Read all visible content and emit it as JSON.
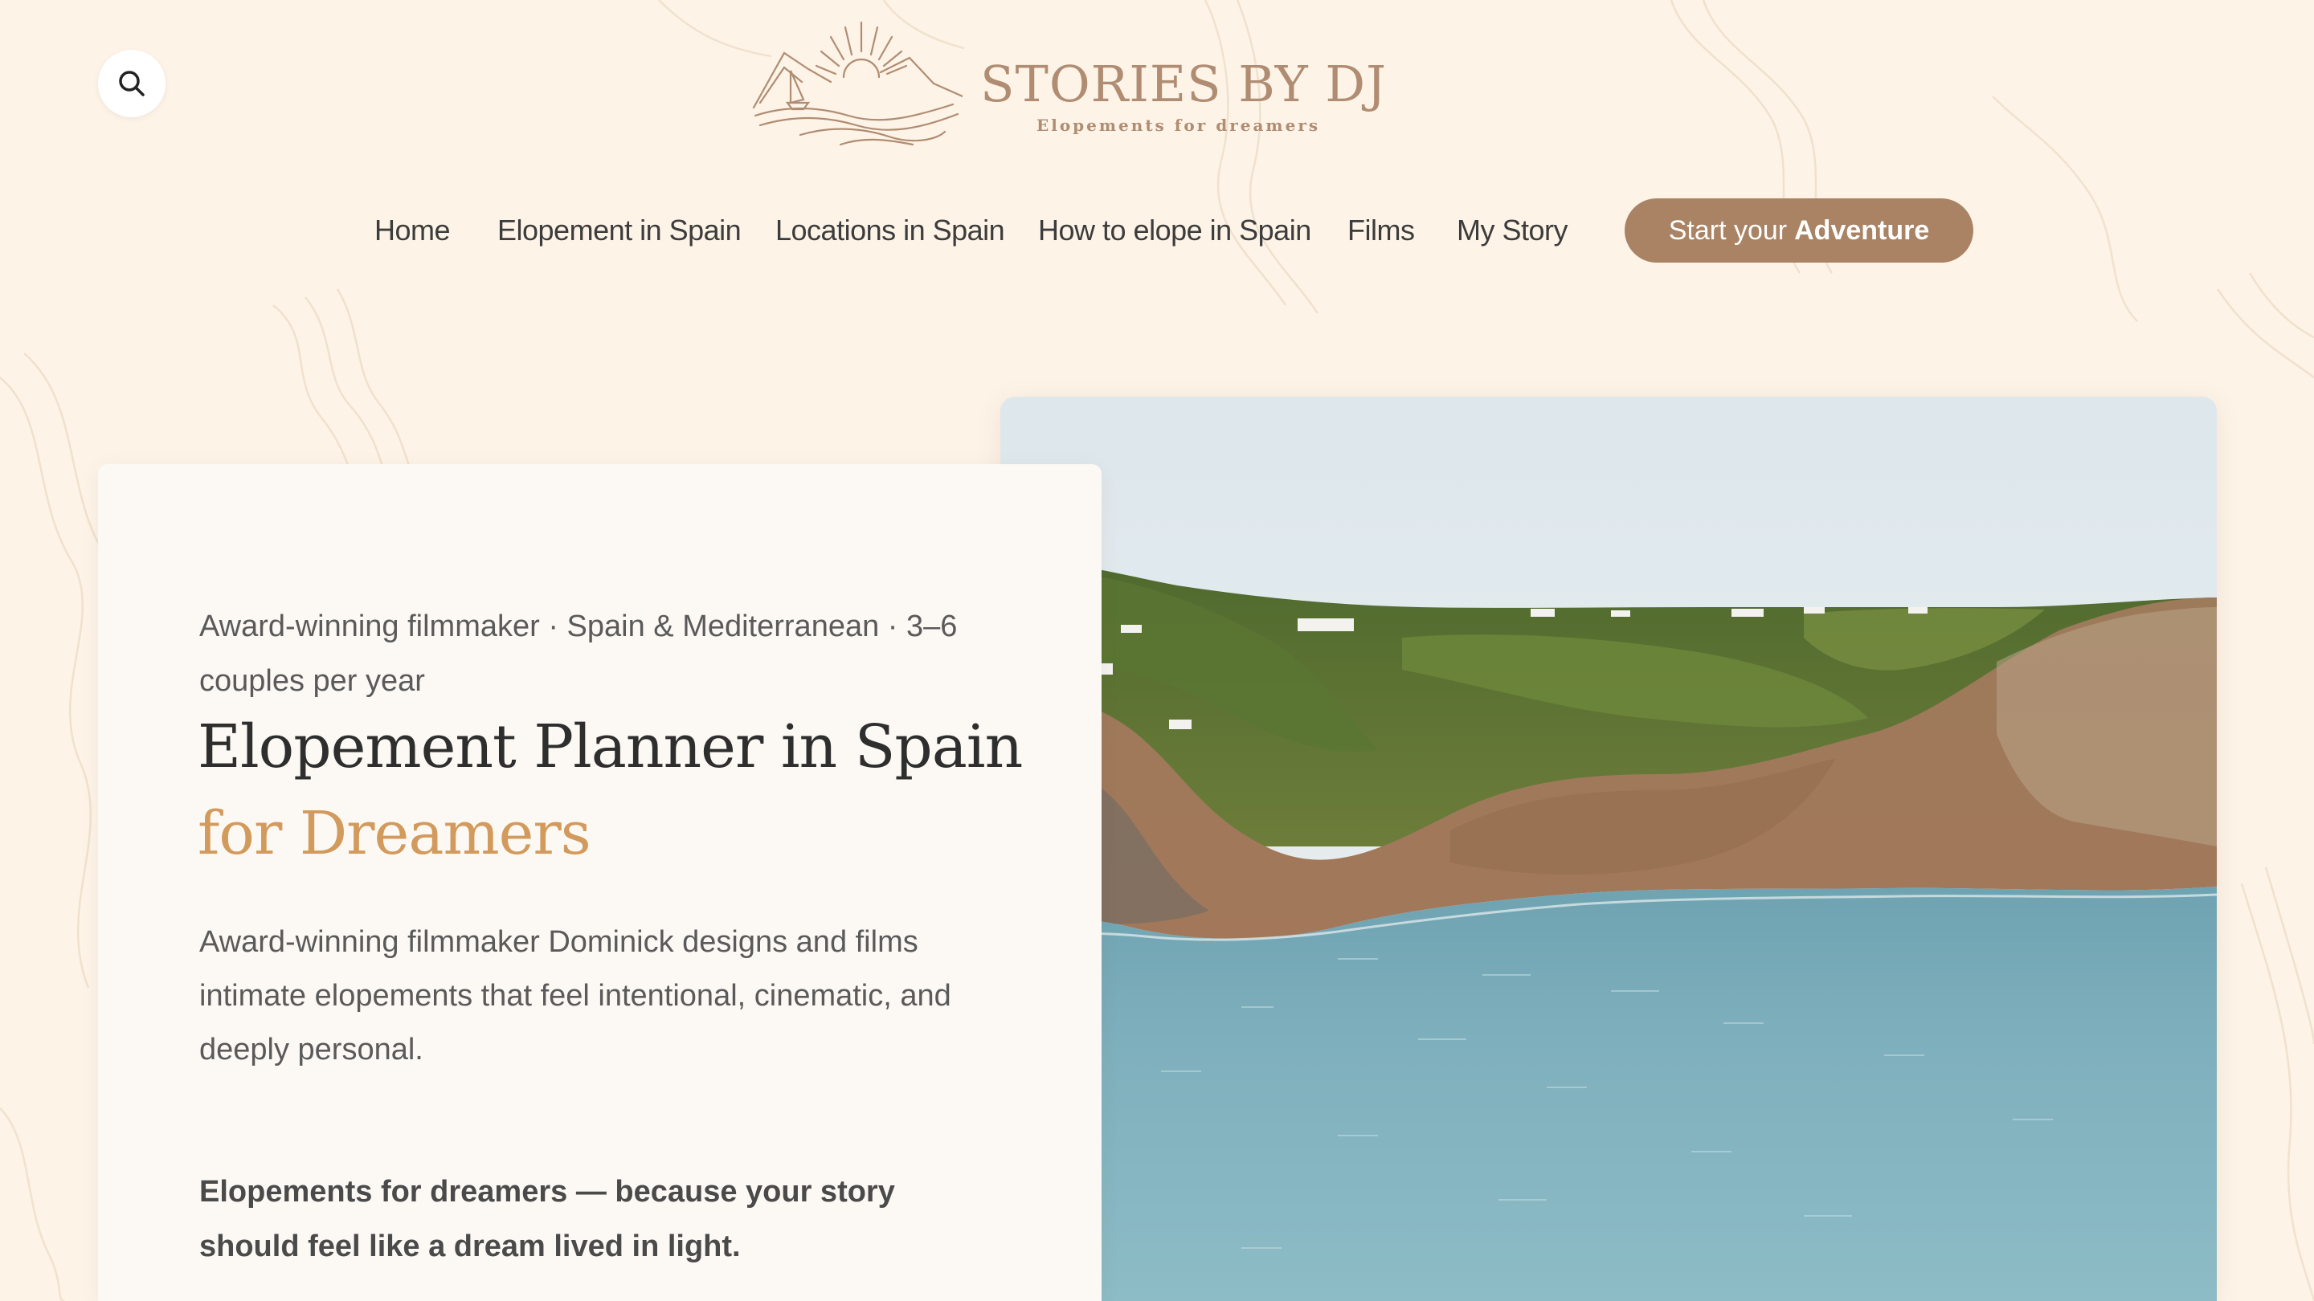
{
  "header": {
    "search_icon": "search-icon",
    "logo": {
      "title": "STORIES BY DJ",
      "tagline": "Elopements for dreamers"
    }
  },
  "nav": {
    "items": [
      {
        "label": "Home"
      },
      {
        "label": "Elopement in Spain"
      },
      {
        "label": "Locations in Spain"
      },
      {
        "label": "How to elope in Spain"
      },
      {
        "label": "Films"
      },
      {
        "label": "My Story"
      }
    ],
    "cta": {
      "prefix": "Start your",
      "emphasis": "Adventure"
    }
  },
  "hero": {
    "eyebrow": "Award-winning filmmaker · Spain & Mediterranean · 3–6 couples per year",
    "headline": "Elopement Planner in Spain",
    "headline_accent": "for Dreamers",
    "description": "Award-winning filmmaker Dominick designs and films intimate elopements that feel intentional, cinematic, and deeply personal.",
    "tagline": "Elopements for dreamers — because your story should feel like a dream lived in light."
  },
  "colors": {
    "background": "#fdf3e7",
    "brand": "#b08d72",
    "cta": "#a98364",
    "accent": "#d29a5c",
    "card": "#fcf9f4"
  }
}
